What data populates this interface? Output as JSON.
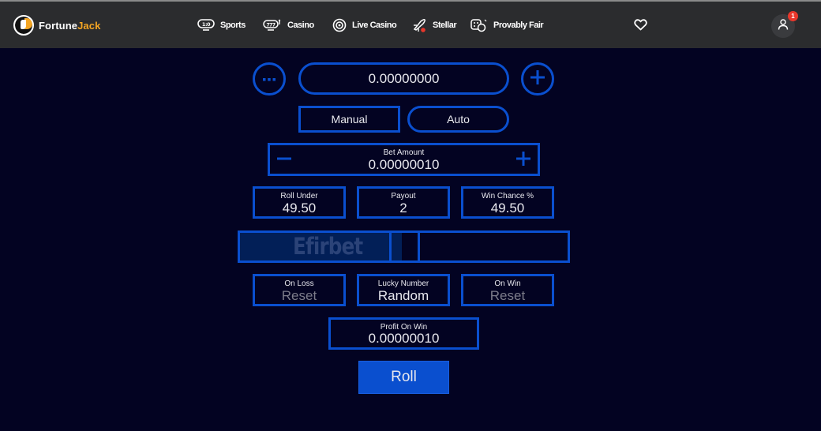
{
  "header": {
    "brand_part1": "Fortune",
    "brand_part2": "Jack",
    "nav": [
      {
        "label": "Sports",
        "icon": "scoreboard-icon"
      },
      {
        "label": "Casino",
        "icon": "slot-777-icon"
      },
      {
        "label": "Live Casino",
        "icon": "target-icon"
      },
      {
        "label": "Stellar",
        "icon": "rocket-icon"
      },
      {
        "label": "Provably Fair",
        "icon": "dice-icon"
      }
    ],
    "notification_count": "1"
  },
  "game": {
    "balance": "0.00000000",
    "modes": {
      "manual": "Manual",
      "auto": "Auto"
    },
    "bet_amount": {
      "label": "Bet Amount",
      "value": "0.00000010"
    },
    "roll_under": {
      "label": "Roll Under",
      "value": "49.50"
    },
    "payout": {
      "label": "Payout",
      "value": "2"
    },
    "win_chance": {
      "label": "Win Chance %",
      "value": "49.50"
    },
    "slider": {
      "watermark": "Efirbet",
      "roll_under_percent": 49.5
    },
    "on_loss": {
      "label": "On Loss",
      "value": "Reset"
    },
    "lucky_number": {
      "label": "Lucky Number",
      "value": "Random"
    },
    "on_win": {
      "label": "On Win",
      "value": "Reset"
    },
    "profit_on_win": {
      "label": "Profit On Win",
      "value": "0.00000010"
    },
    "roll_label": "Roll"
  },
  "colors": {
    "accent_blue": "#0a4fcf",
    "background": "#030322",
    "header_bg": "#2b2c2e",
    "brand_yellow": "#f5a623",
    "badge_red": "#e8372b"
  }
}
